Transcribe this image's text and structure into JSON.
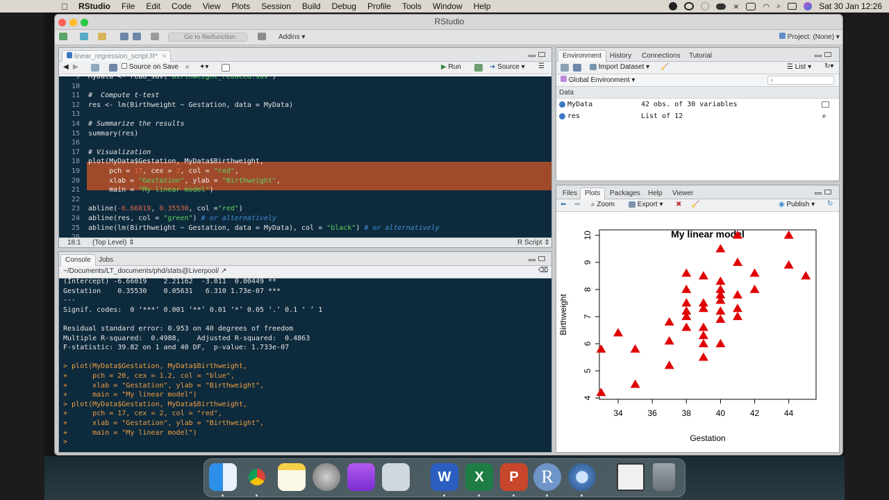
{
  "menubar": {
    "app": "RStudio",
    "items": [
      "File",
      "Edit",
      "Code",
      "View",
      "Plots",
      "Session",
      "Build",
      "Debug",
      "Profile",
      "Tools",
      "Window",
      "Help"
    ],
    "clock": "Sat 30 Jan  12:26"
  },
  "window": {
    "title": "RStudio"
  },
  "toolbar": {
    "goto_placeholder": "Go to file/function",
    "addins": "Addins",
    "project": "Project: (None)"
  },
  "editor": {
    "tab": "linear_regression_script.R*",
    "source_on_save": "Source on Save",
    "run": "Run",
    "source": "Source",
    "status_pos": "18:1",
    "status_scope": "(Top Level)",
    "status_lang": "R Script",
    "lines": [
      {
        "n": "9",
        "t": "MyData <- read_sav(\"Birthweight_reduced.sav\")"
      },
      {
        "n": "10",
        "t": ""
      },
      {
        "n": "11",
        "t": "#  Compute t-test"
      },
      {
        "n": "12",
        "t": "res <- lm(Birthweight ~ Gestation, data = MyData)"
      },
      {
        "n": "13",
        "t": ""
      },
      {
        "n": "14",
        "t": "# Summarize the results"
      },
      {
        "n": "15",
        "t": "summary(res)"
      },
      {
        "n": "16",
        "t": ""
      },
      {
        "n": "17",
        "t": "# Visualization"
      },
      {
        "n": "18",
        "t": "plot(MyData$Gestation, MyData$Birthweight,"
      },
      {
        "n": "19",
        "t": "     pch = 17, cex = 2, col = \"red\","
      },
      {
        "n": "20",
        "t": "     xlab = \"Gestation\", ylab = \"Birthweight\","
      },
      {
        "n": "21",
        "t": "     main = \"My linear model\")"
      },
      {
        "n": "22",
        "t": ""
      },
      {
        "n": "23",
        "t": "abline(-6.66019, 0.35530, col =\"red\")"
      },
      {
        "n": "24",
        "t": "abline(res, col = \"green\") # or alternatively"
      },
      {
        "n": "25",
        "t": "abline(lm(Birthweight ~ Gestation, data = MyData), col = \"black\") # or alternatively"
      },
      {
        "n": "26",
        "t": ""
      }
    ]
  },
  "console": {
    "tabs": [
      "Console",
      "Jobs"
    ],
    "path": "~/Documents/LT_documents/phd/stats@Liverpool/",
    "lines": [
      {
        "k": "out",
        "t": "(Intercept) -6.66019    2.21162  -3.011  0.00449 **"
      },
      {
        "k": "out",
        "t": "Gestation    0.35530    0.05631   6.310 1.73e-07 ***"
      },
      {
        "k": "out",
        "t": "---"
      },
      {
        "k": "out",
        "t": "Signif. codes:  0 ‘***’ 0.001 ‘**’ 0.01 ‘*’ 0.05 ‘.’ 0.1 ‘ ’ 1"
      },
      {
        "k": "out",
        "t": ""
      },
      {
        "k": "out",
        "t": "Residual standard error: 0.953 on 40 degrees of freedom"
      },
      {
        "k": "out",
        "t": "Multiple R-squared:  0.4988,    Adjusted R-squared:  0.4863"
      },
      {
        "k": "out",
        "t": "F-statistic: 39.82 on 1 and 40 DF,  p-value: 1.733e-07"
      },
      {
        "k": "out",
        "t": ""
      },
      {
        "k": "cmd",
        "t": "> plot(MyData$Gestation, MyData$Birthweight,"
      },
      {
        "k": "cmd",
        "t": "+      pch = 20, cex = 1.2, col = \"blue\","
      },
      {
        "k": "cmd",
        "t": "+      xlab = \"Gestation\", ylab = \"Birthweight\","
      },
      {
        "k": "cmd",
        "t": "+      main = \"My linear model\")"
      },
      {
        "k": "cmd",
        "t": "> plot(MyData$Gestation, MyData$Birthweight,"
      },
      {
        "k": "cmd",
        "t": "+      pch = 17, cex = 2, col = \"red\","
      },
      {
        "k": "cmd",
        "t": "+      xlab = \"Gestation\", ylab = \"Birthweight\","
      },
      {
        "k": "cmd",
        "t": "+      main = \"My linear model\")"
      },
      {
        "k": "cmd",
        "t": ">"
      }
    ]
  },
  "environment": {
    "tabs": [
      "Environment",
      "History",
      "Connections",
      "Tutorial"
    ],
    "import_dataset": "Import Dataset",
    "list_view": "List",
    "global_env": "Global Environment",
    "section": "Data",
    "rows": [
      {
        "name": "MyData",
        "value": "42 obs. of 30 variables"
      },
      {
        "name": "res",
        "value": "List of 12"
      }
    ]
  },
  "plots": {
    "tabs": [
      "Files",
      "Plots",
      "Packages",
      "Help",
      "Viewer"
    ],
    "zoom": "Zoom",
    "export": "Export",
    "publish": "Publish"
  },
  "chart_data": {
    "type": "scatter",
    "title": "My linear model",
    "xlabel": "Gestation",
    "ylabel": "Birthweight",
    "xlim": [
      32.9,
      45.6
    ],
    "ylim": [
      3.95,
      10.2
    ],
    "xticks": [
      34,
      36,
      38,
      40,
      42,
      44
    ],
    "yticks": [
      4,
      5,
      6,
      7,
      8,
      9,
      10
    ],
    "marker": "triangle",
    "color": "#e00000",
    "points": [
      [
        33,
        5.8
      ],
      [
        33,
        4.2
      ],
      [
        34,
        6.4
      ],
      [
        35,
        5.8
      ],
      [
        35,
        4.5
      ],
      [
        37,
        6.8
      ],
      [
        37,
        6.1
      ],
      [
        37,
        5.2
      ],
      [
        38,
        8.6
      ],
      [
        38,
        8.0
      ],
      [
        38,
        7.5
      ],
      [
        38,
        7.2
      ],
      [
        38,
        7.0
      ],
      [
        38,
        6.6
      ],
      [
        39,
        8.5
      ],
      [
        39,
        7.5
      ],
      [
        39,
        7.3
      ],
      [
        39,
        6.6
      ],
      [
        39,
        6.3
      ],
      [
        39,
        6.0
      ],
      [
        39,
        5.5
      ],
      [
        40,
        9.5
      ],
      [
        40,
        8.3
      ],
      [
        40,
        8.0
      ],
      [
        40,
        7.8
      ],
      [
        40,
        7.6
      ],
      [
        40,
        7.2
      ],
      [
        40,
        6.9
      ],
      [
        40,
        6.0
      ],
      [
        41,
        10.0
      ],
      [
        41,
        9.0
      ],
      [
        41,
        7.8
      ],
      [
        41,
        7.3
      ],
      [
        41,
        7.0
      ],
      [
        42,
        8.6
      ],
      [
        42,
        8.0
      ],
      [
        44,
        10.0
      ],
      [
        44,
        8.9
      ],
      [
        45,
        8.5
      ]
    ]
  }
}
